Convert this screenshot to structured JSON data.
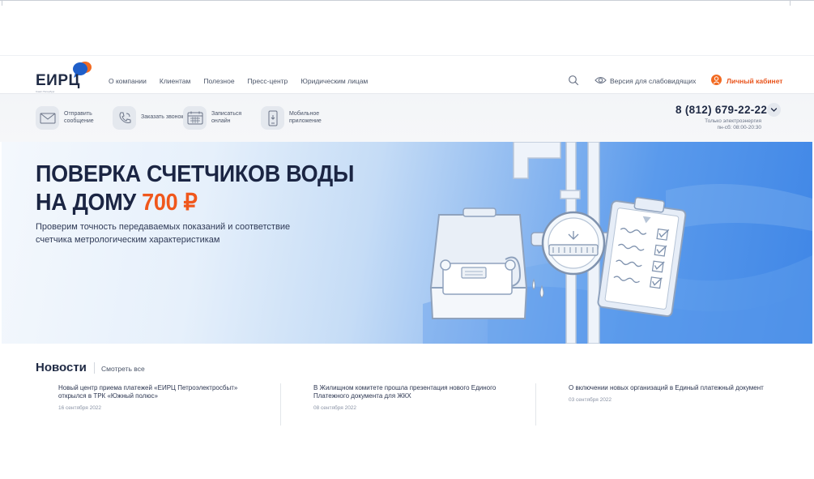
{
  "header": {
    "logo_text": "ЕИРЦ",
    "logo_sub": "Санкт-Петербург",
    "nav": [
      "О компании",
      "Клиентам",
      "Полезное",
      "Пресс-центр",
      "Юридическим лицам"
    ],
    "vision_label": "Версия для слабовидящих",
    "cabinet_label": "Личный кабинет"
  },
  "services": [
    {
      "label": "Отправить сообщение",
      "icon": "envelope-icon"
    },
    {
      "label": "Заказать звонок",
      "icon": "phone-call-icon"
    },
    {
      "label": "Записаться онлайн",
      "icon": "calendar-icon"
    },
    {
      "label": "Мобильное приложение",
      "icon": "mobile-app-icon"
    }
  ],
  "phone": {
    "number": "8 (812) 679-22-22",
    "note_line1": "Только электроэнергия",
    "note_line2": "пн-сб: 08:00-20:30"
  },
  "banner": {
    "title_line1": "ПОВЕРКА СЧЕТЧИКОВ ВОДЫ",
    "title_line2_prefix": "НА ДОМУ",
    "price": "700 ₽",
    "description": "Проверим точность передаваемых показаний и соответствие счетчика метрологическим характеристикам"
  },
  "news": {
    "title": "Новости",
    "see_all": "Смотреть все",
    "items": [
      {
        "text": "Новый центр приема платежей «ЕИРЦ Петроэлектросбыт» открылся в ТРК «Южный полюс»",
        "date": "16 сентября 2022"
      },
      {
        "text": "В Жилищном комитете прошла презентация нового Единого Платежного документа для ЖКХ",
        "date": "08 сентября 2022"
      },
      {
        "text": "О включении новых организаций в Единый платежный документ",
        "date": "03 сентября 2022"
      }
    ]
  },
  "colors": {
    "accent": "#f0571c",
    "brand_dark": "#1b2543",
    "brand_blue": "#3f86e6"
  }
}
